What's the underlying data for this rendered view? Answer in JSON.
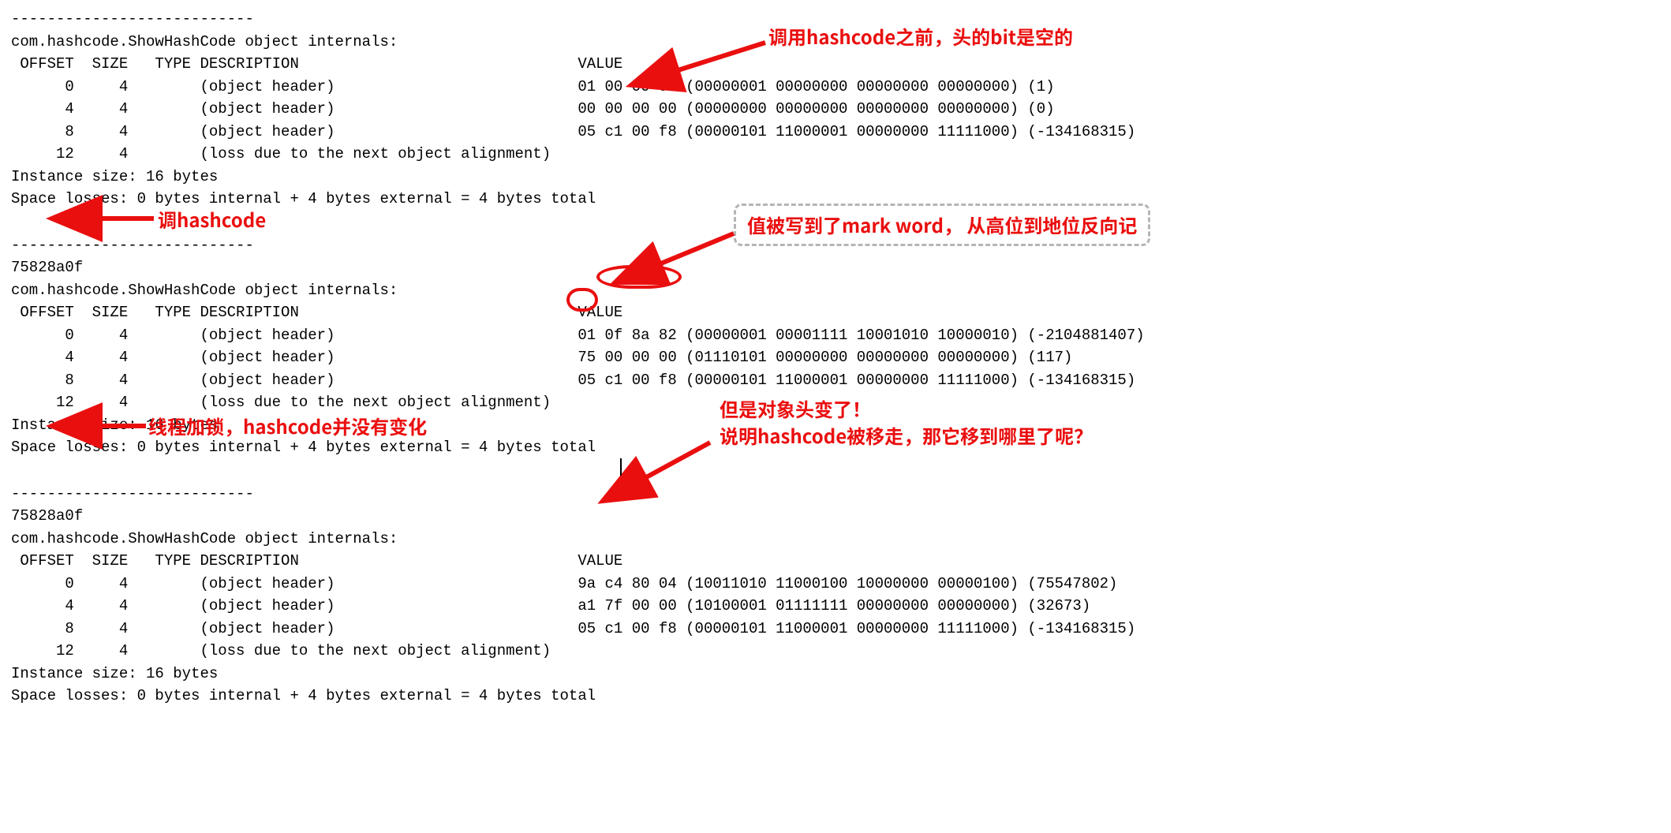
{
  "sep": "---------------------------",
  "internals_title": "com.hashcode.ShowHashCode object internals:",
  "header_line": " OFFSET  SIZE   TYPE DESCRIPTION                               VALUE",
  "instance_size": "Instance size: 16 bytes",
  "space_losses": "Space losses: 0 bytes internal + 4 bytes external = 4 bytes total",
  "hash_code": "75828a0f",
  "block1": {
    "rows": [
      "      0     4        (object header)                           01 00 00 00 (00000001 00000000 00000000 00000000) (1)",
      "      4     4        (object header)                           00 00 00 00 (00000000 00000000 00000000 00000000) (0)",
      "      8     4        (object header)                           05 c1 00 f8 (00000101 11000001 00000000 11111000) (-134168315)",
      "     12     4        (loss due to the next object alignment)"
    ]
  },
  "block2": {
    "rows": [
      "      0     4        (object header)                           01 0f 8a 82 (00000001 00001111 10001010 10000010) (-2104881407)",
      "      4     4        (object header)                           75 00 00 00 (01110101 00000000 00000000 00000000) (117)",
      "      8     4        (object header)                           05 c1 00 f8 (00000101 11000001 00000000 11111000) (-134168315)",
      "     12     4        (loss due to the next object alignment)"
    ]
  },
  "block3": {
    "rows": [
      "      0     4        (object header)                           9a c4 80 04 (10011010 11000100 10000000 00000100) (75547802)",
      "      4     4        (object header)                           a1 7f 00 00 (10100001 01111111 00000000 00000000) (32673)",
      "      8     4        (object header)                           05 c1 00 f8 (00000101 11000001 00000000 11111000) (-134168315)",
      "     12     4        (loss due to the next object alignment)"
    ]
  },
  "annotations": {
    "ann1": "调用hashcode之前，头的bit是空的",
    "ann2": "调hashcode",
    "ann3": "值被写到了mark word， 从高位到地位反向记",
    "ann4": "线程加锁，hashcode并没有变化",
    "ann5a": "但是对象头变了！",
    "ann5b": "说明hashcode被移走，那它移到哪里了呢？"
  }
}
